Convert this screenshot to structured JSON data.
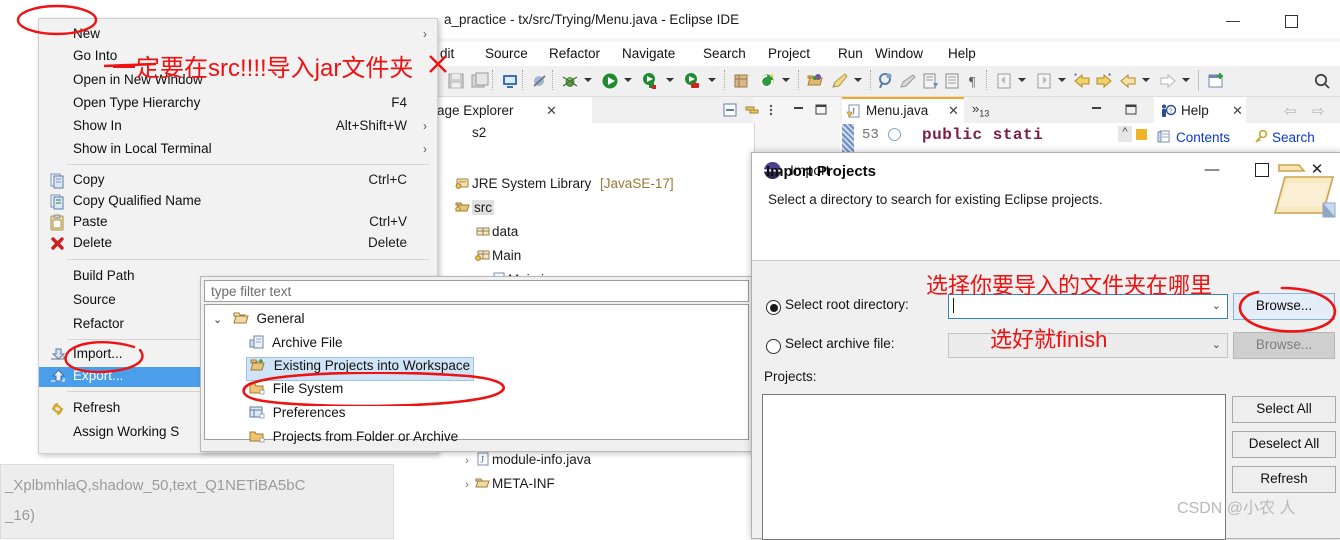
{
  "eclipse": {
    "title": "a_practice - tx/src/Trying/Menu.java - Eclipse IDE",
    "window_buttons": {
      "minimize": "—",
      "maximize": "▢"
    },
    "menubar": [
      "dit",
      "Source",
      "Refactor",
      "Navigate",
      "Search",
      "Project",
      "Run",
      "Window",
      "Help"
    ],
    "package_explorer": {
      "tab_label": "age Explorer",
      "close": "✕",
      "tree": [
        {
          "chevron": "",
          "icon": "project-icon",
          "label": "s2"
        },
        {
          "chevron": "",
          "icon": "jre-icon",
          "label": "JRE System Library",
          "suffix": "[JavaSE-17]"
        },
        {
          "chevron": "",
          "icon": "source-folder-icon",
          "label": "src",
          "selected": true
        },
        {
          "chevron": "",
          "icon": "package-icon",
          "label": "data"
        },
        {
          "chevron": "",
          "icon": "package-icon",
          "label": "Main"
        },
        {
          "chevron": "›",
          "icon": "java-file-icon",
          "label": "Main.java"
        },
        {
          "chevron": "›",
          "icon": "java-file-icon",
          "label": "module-info.java"
        },
        {
          "chevron": "›",
          "icon": "folder-icon",
          "label": "META-INF"
        }
      ]
    },
    "editor": {
      "tab_label": "Menu.java",
      "close": "✕",
      "overflow": "»",
      "overflow_count": "13",
      "line_number": "53",
      "code": "public stati"
    },
    "help_view": {
      "tab_label": "Help",
      "close": "✕",
      "links": [
        "Contents",
        "Search"
      ],
      "nav_back": "⇦",
      "nav_forward": "⇨"
    }
  },
  "context_menu": {
    "items": [
      {
        "label": "New",
        "accel": "",
        "arrow": "›",
        "icon": ""
      },
      {
        "label": "Go Into",
        "accel": "",
        "arrow": "",
        "icon": ""
      },
      {
        "label": "Open in New Window",
        "accel": "",
        "arrow": "",
        "icon": ""
      },
      {
        "label": "Open Type Hierarchy",
        "accel": "F4",
        "arrow": "",
        "icon": ""
      },
      {
        "label": "Show In",
        "accel": "Alt+Shift+W",
        "arrow": "›",
        "icon": ""
      },
      {
        "label": "Show in Local Terminal",
        "accel": "",
        "arrow": "›",
        "icon": ""
      },
      {
        "label": "Copy",
        "accel": "Ctrl+C",
        "arrow": "",
        "icon": "copy-icon"
      },
      {
        "label": "Copy Qualified Name",
        "accel": "",
        "arrow": "",
        "icon": "copy-qualified-icon"
      },
      {
        "label": "Paste",
        "accel": "Ctrl+V",
        "arrow": "",
        "icon": "paste-icon"
      },
      {
        "label": "Delete",
        "accel": "Delete",
        "arrow": "",
        "icon": "delete-icon"
      },
      {
        "label": "Build Path",
        "accel": "",
        "arrow": "",
        "icon": ""
      },
      {
        "label": "Source",
        "accel": "",
        "arrow": "",
        "icon": ""
      },
      {
        "label": "Refactor",
        "accel": "",
        "arrow": "",
        "icon": ""
      },
      {
        "label": "Import...",
        "accel": "",
        "arrow": "",
        "icon": "import-icon"
      },
      {
        "label": "Export...",
        "accel": "",
        "arrow": "",
        "icon": "export-icon",
        "selected": true
      },
      {
        "label": "Refresh",
        "accel": "",
        "arrow": "",
        "icon": "refresh-icon"
      },
      {
        "label": "Assign Working S",
        "accel": "",
        "arrow": "",
        "icon": ""
      }
    ]
  },
  "import_wizard": {
    "filter_placeholder": "type filter text",
    "tree": [
      {
        "label": "General",
        "icon": "open-folder-icon",
        "level": 0,
        "chevron": "⌄"
      },
      {
        "label": "Archive File",
        "icon": "archive-icon",
        "level": 1,
        "chevron": ""
      },
      {
        "label": "Existing Projects into Workspace",
        "icon": "existing-projects-icon",
        "level": 1,
        "chevron": "",
        "selected": true
      },
      {
        "label": "File System",
        "icon": "folder-icon",
        "level": 1,
        "chevron": ""
      },
      {
        "label": "Preferences",
        "icon": "preferences-icon",
        "level": 1,
        "chevron": ""
      },
      {
        "label": "Projects from Folder or Archive",
        "icon": "folder-icon",
        "level": 1,
        "chevron": ""
      }
    ]
  },
  "import_dialog": {
    "window_title": "Import",
    "window_buttons": {
      "minimize": "—",
      "maximize": "▢",
      "close": "✕"
    },
    "heading": "Import Projects",
    "description": "Select a directory to search for existing Eclipse projects.",
    "root_directory": {
      "label": "Select root directory:",
      "value": "",
      "selected": true,
      "browse": "Browse..."
    },
    "archive_file": {
      "label": "Select archive file:",
      "value": "",
      "selected": false,
      "browse": "Browse..."
    },
    "projects_label": "Projects:",
    "side_buttons": [
      "Select All",
      "Deselect All",
      "Refresh"
    ],
    "watermark": "CSDN @小农 人"
  },
  "overlay_bottom_left": {
    "line1": "_XplbmhlaQ,shadow_50,text_Q1NETiBA5bC",
    "line2": "_16)"
  },
  "annotations": {
    "note_src": "一定要在src!!!!导入jar文件夹",
    "note_choose_folder": "选择你要导入的文件夹在哪里",
    "note_finish": "选好就finish",
    "ink_color": "#ee1212"
  }
}
